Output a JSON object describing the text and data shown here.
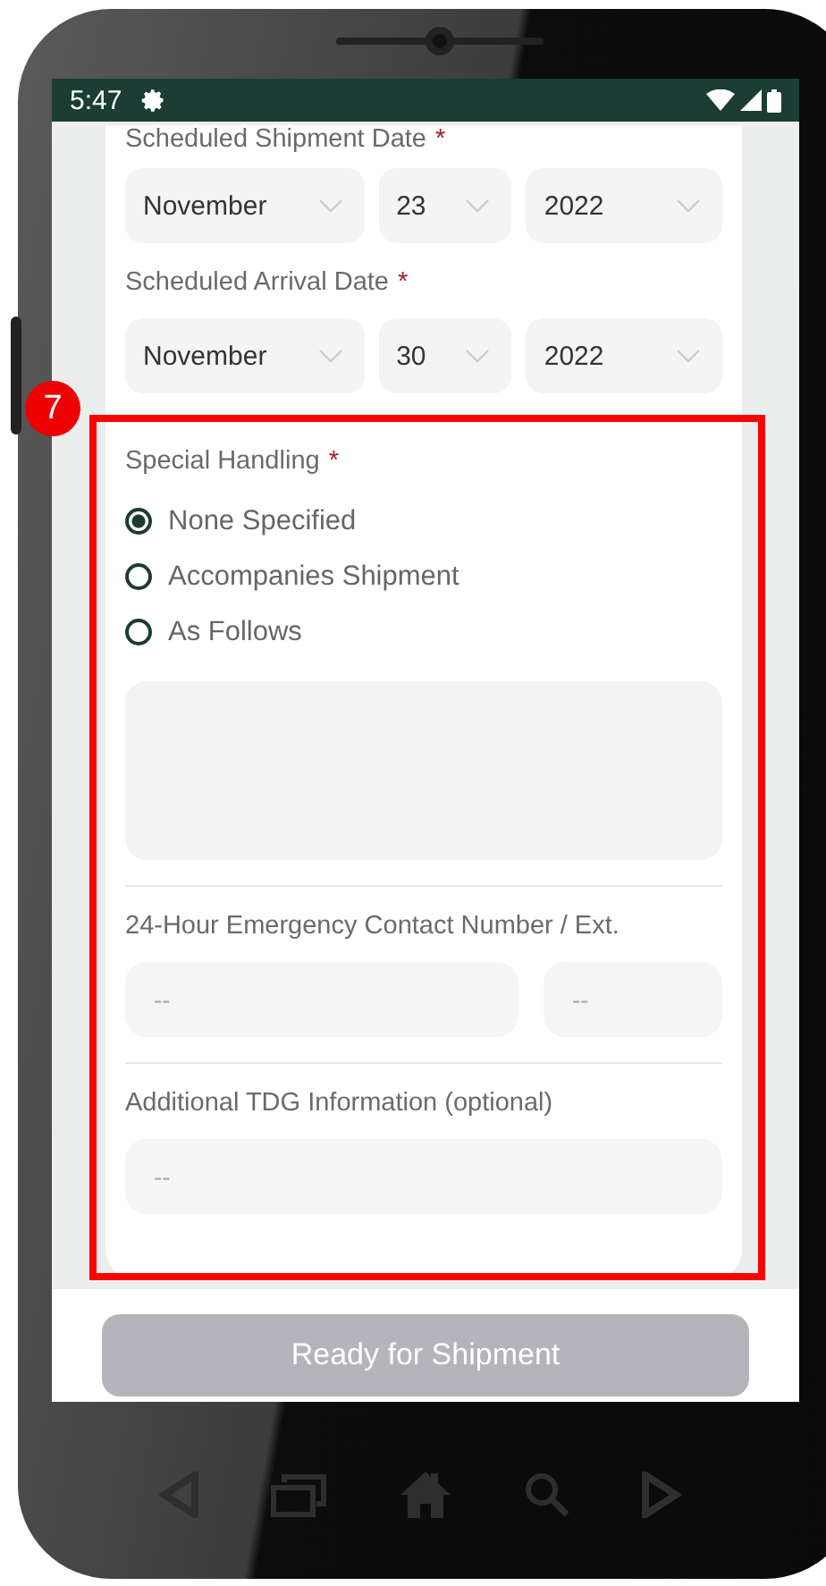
{
  "status_bar": {
    "time": "5:47"
  },
  "shipment_date": {
    "label": "Scheduled Shipment Date",
    "required_mark": "*",
    "month": "November",
    "day": "23",
    "year": "2022"
  },
  "arrival_date": {
    "label": "Scheduled Arrival Date",
    "required_mark": "*",
    "month": "November",
    "day": "30",
    "year": "2022"
  },
  "special_handling": {
    "label": "Special Handling",
    "required_mark": "*",
    "options": [
      {
        "label": "None Specified",
        "selected": true
      },
      {
        "label": "Accompanies Shipment",
        "selected": false
      },
      {
        "label": "As Follows",
        "selected": false
      }
    ]
  },
  "emergency_contact": {
    "label": "24-Hour Emergency Contact Number / Ext.",
    "number_placeholder": "--",
    "ext_placeholder": "--"
  },
  "additional_info": {
    "label": "Additional TDG Information (optional)",
    "placeholder": "--"
  },
  "submit_button": {
    "label": "Ready for Shipment",
    "disabled": true
  },
  "annotation": {
    "number": "7"
  }
}
